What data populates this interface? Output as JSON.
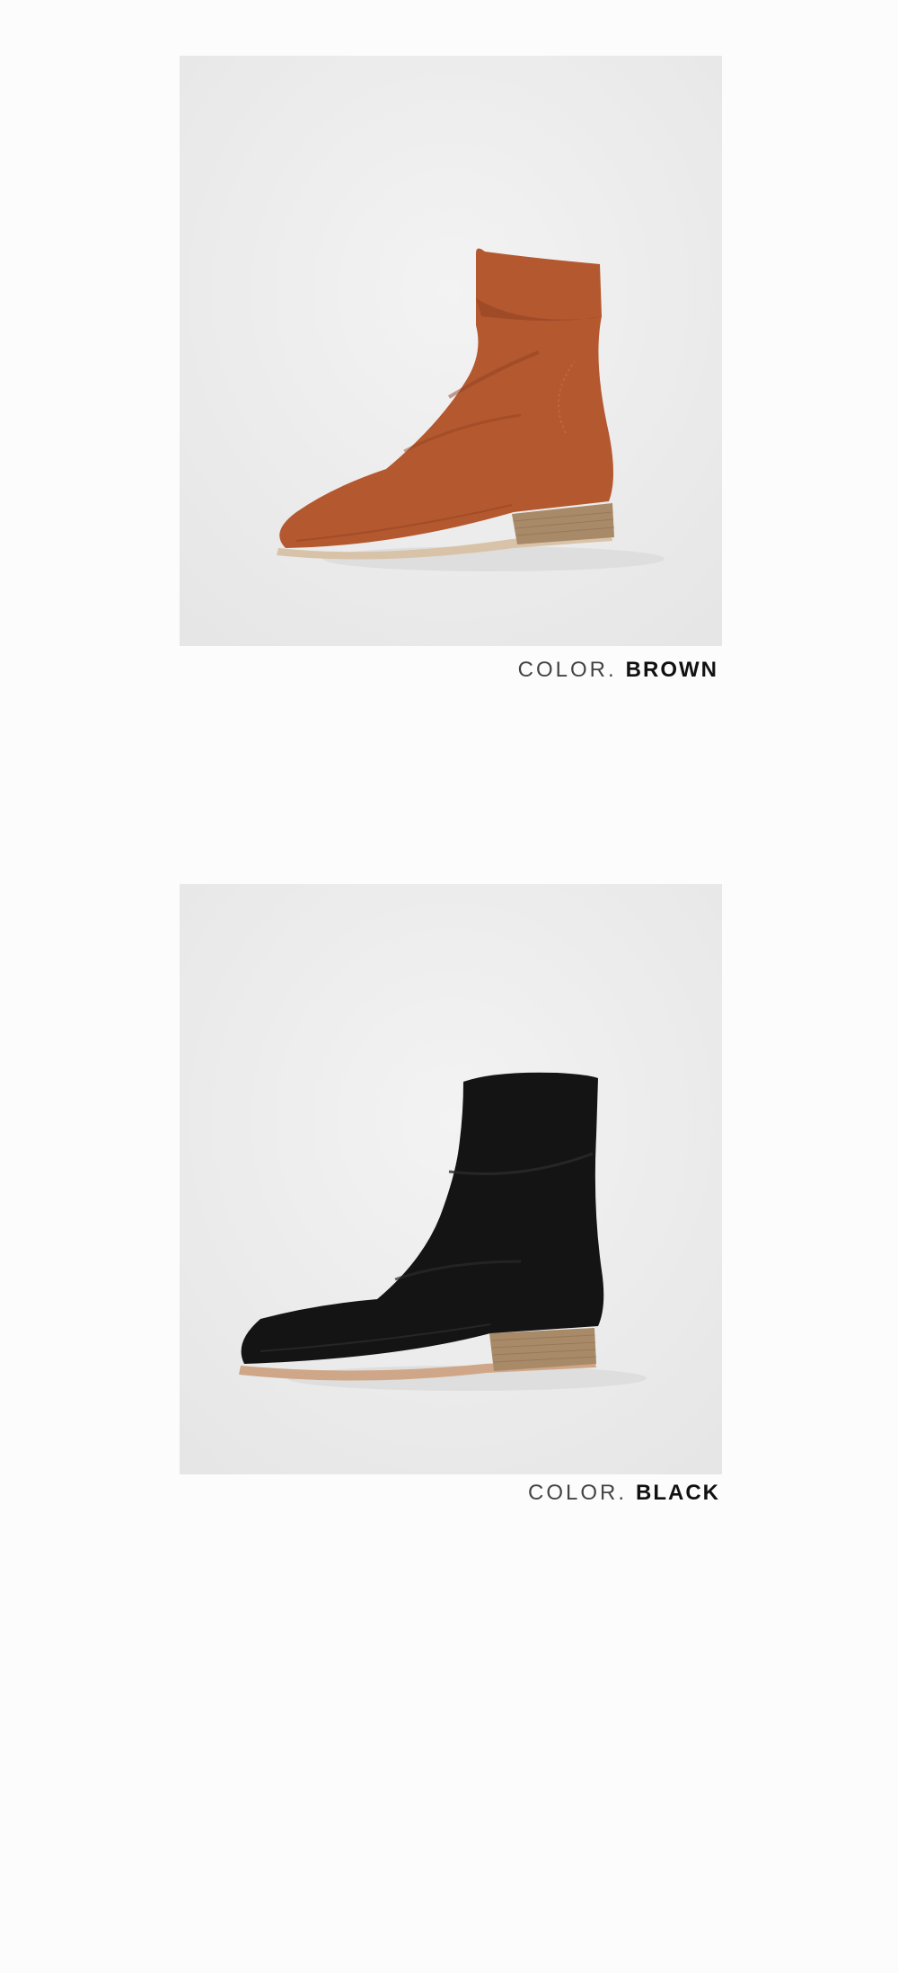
{
  "variants": [
    {
      "caption_prefix": "COLOR.",
      "caption_name": "BROWN",
      "boot_color": "#b4582f",
      "boot_shadow": "#8f4222",
      "heel_color": "#a88a68",
      "sole_color": "#d9c3a8"
    },
    {
      "caption_prefix": "COLOR.",
      "caption_name": "BLACK",
      "boot_color": "#141414",
      "boot_shadow": "#050505",
      "heel_color": "#a88a68",
      "sole_color": "#cfa788"
    }
  ]
}
